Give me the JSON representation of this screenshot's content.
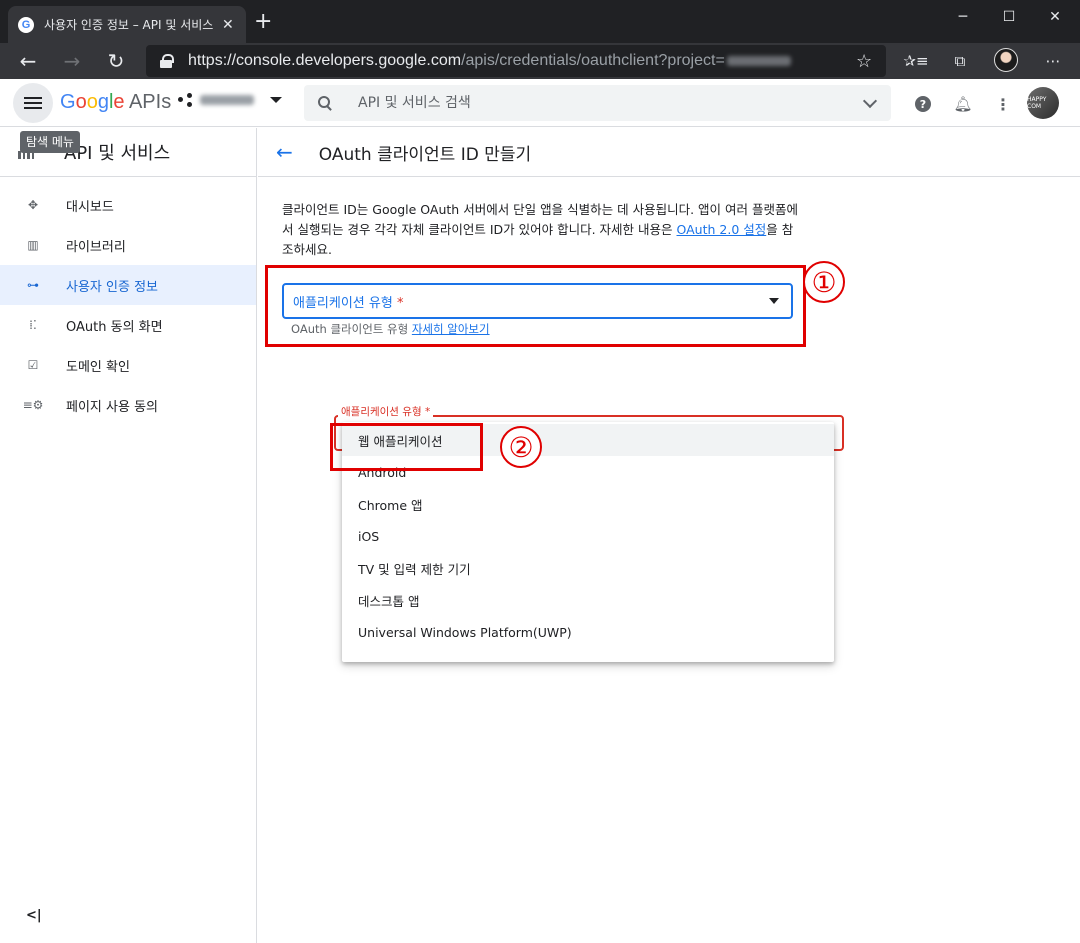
{
  "browser": {
    "tab_title": "사용자 인증 정보 – API 및 서비스",
    "favicon_letter": "G",
    "url_main": "https://console.developers.google.com",
    "url_rest": "/apis/credentials/oauthclient?project=",
    "window_controls": {
      "minimize": "─",
      "maximize": "☐",
      "close": "✕"
    }
  },
  "header": {
    "logo": {
      "g1": "G",
      "g2": "o",
      "g3": "o",
      "g1b": "g",
      "g4": "l",
      "g2b": "e",
      "apis": " APIs"
    },
    "menu_tooltip": "탐색 메뉴",
    "search_placeholder": "API 및 서비스 검색",
    "avatar_text": "HAPPY COM"
  },
  "sidebar": {
    "title": "API 및 서비스",
    "items": [
      {
        "label": "대시보드",
        "icon": "dashboard-icon",
        "glyph": "✥"
      },
      {
        "label": "라이브러리",
        "icon": "library-icon",
        "glyph": "▥"
      },
      {
        "label": "사용자 인증 정보",
        "icon": "key-icon",
        "glyph": "⊶"
      },
      {
        "label": "OAuth 동의 화면",
        "icon": "consent-icon",
        "glyph": "⁞⁚"
      },
      {
        "label": "도메인 확인",
        "icon": "domain-check-icon",
        "glyph": "☑"
      },
      {
        "label": "페이지 사용 동의",
        "icon": "page-settings-icon",
        "glyph": "≡⚙"
      }
    ],
    "collapse_label": "<|"
  },
  "main": {
    "title": "OAuth 클라이언트 ID 만들기",
    "description_prefix": "클라이언트 ID는 Google OAuth 서버에서 단일 앱을 식별하는 데 사용됩니다. 앱이 여러 플랫폼에서 실행되는 경우 각각 자체 클라이언트 ID가 있어야 합니다. 자세한 내용은 ",
    "description_link": "OAuth 2.0 설정",
    "description_suffix": "을 참조하세요.",
    "app_type_label": "애플리케이션 유형",
    "required_mark": "*",
    "hint_prefix": "OAuth 클라이언트 유형 ",
    "hint_link": "자세히 알아보기",
    "dropdown_label": "애플리케이션 유형 *",
    "options": [
      "웹 애플리케이션",
      "Android",
      "Chrome 앱",
      "iOS",
      "TV 및 입력 제한 기기",
      "데스크톱 앱",
      "Universal Windows Platform(UWP)"
    ]
  },
  "annotations": {
    "step1": "①",
    "step2": "②"
  },
  "colors": {
    "accent": "#1a73e8",
    "annotation": "#e00000",
    "error": "#d93025",
    "active_bg": "#e8f0fe"
  }
}
